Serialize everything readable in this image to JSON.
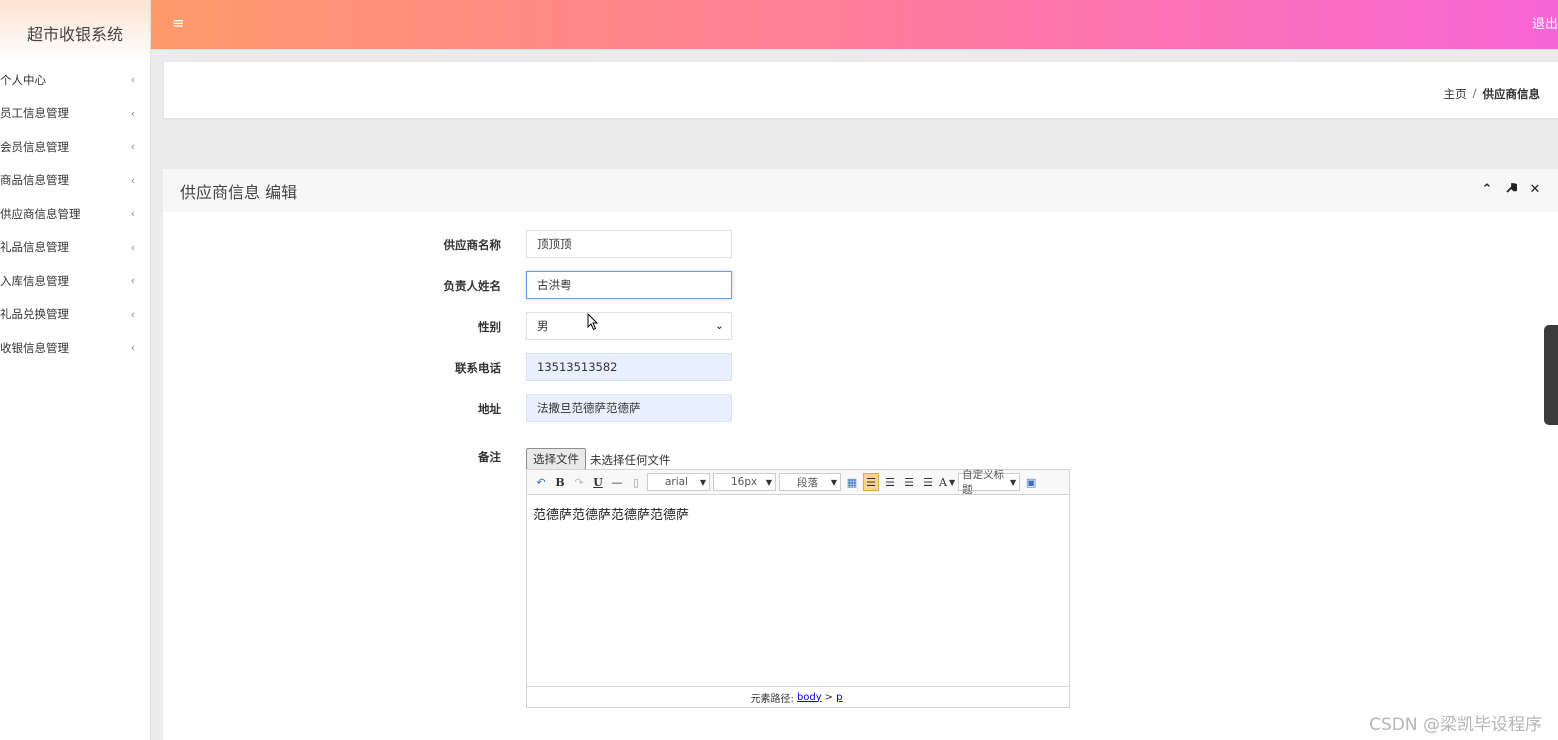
{
  "app": {
    "title": "超市收银系统",
    "logout": "退出",
    "hamburger_icon": "menu-icon"
  },
  "sidebar": {
    "items": [
      {
        "label": "个人中心"
      },
      {
        "label": "员工信息管理"
      },
      {
        "label": "会员信息管理"
      },
      {
        "label": "商品信息管理"
      },
      {
        "label": "供应商信息管理"
      },
      {
        "label": "礼品信息管理"
      },
      {
        "label": "入库信息管理"
      },
      {
        "label": "礼品兑换管理"
      },
      {
        "label": "收银信息管理"
      }
    ],
    "chevron": "‹"
  },
  "breadcrumb": {
    "home": "主页",
    "sep": "/",
    "current": "供应商信息"
  },
  "panel": {
    "title": "供应商信息 编辑",
    "tools": {
      "collapse": "⌃",
      "settings": "🔧",
      "close": "✕"
    }
  },
  "form": {
    "supplier_name": {
      "label": "供应商名称",
      "value": "顶顶顶"
    },
    "contact_name": {
      "label": "负责人姓名",
      "value": "古洪粤"
    },
    "gender": {
      "label": "性别",
      "value": "男"
    },
    "phone": {
      "label": "联系电话",
      "value": "13513513582"
    },
    "address": {
      "label": "地址",
      "value": "法撒旦范德萨范德萨"
    },
    "remark": {
      "label": "备注",
      "file_button": "选择文件",
      "file_status": "未选择任何文件"
    }
  },
  "editor": {
    "toolbar": {
      "font": "arial",
      "size": "16px",
      "paragraph": "段落",
      "custom_title": "自定义标题",
      "bold": "B",
      "underline": "U",
      "font_color": "A"
    },
    "content": "范德萨范德萨范德萨范德萨",
    "footer": {
      "prefix": "元素路径:",
      "body": "body",
      "gt": ">",
      "p": "p"
    }
  },
  "watermark": "CSDN @梁凯毕设程序"
}
